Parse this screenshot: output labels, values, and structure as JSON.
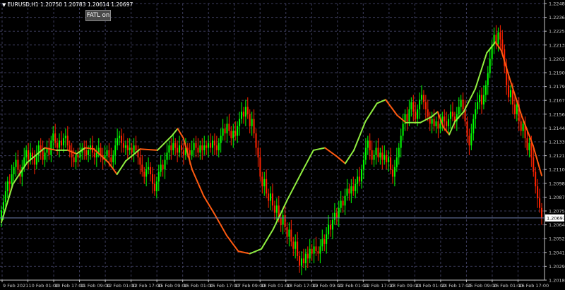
{
  "header": {
    "symbol_menu_icon": "triangle-down-icon",
    "symbol_info": "EURUSD,H1  1.20750 1.20783 1.20614 1.20697"
  },
  "indicator_button": {
    "label": "FATL on"
  },
  "colors": {
    "background": "#000000",
    "grid": "#3c3c5c",
    "axis": "#c8c8c8",
    "bull_candle": "#00ff00",
    "bear_candle": "#ff2200",
    "fatl_up": "#90ee40",
    "fatl_down": "#ff5a10",
    "price_line": "#7080b0"
  },
  "chart_data": {
    "type": "candlestick",
    "symbol": "EURUSD",
    "timeframe": "H1",
    "ylim": [
      1.2018,
      1.2248
    ],
    "y_ticks": [
      "1.22480",
      "1.22365",
      "1.22250",
      "1.22135",
      "1.22020",
      "1.21905",
      "1.21790",
      "1.21675",
      "1.21560",
      "1.21445",
      "1.21330",
      "1.21215",
      "1.21100",
      "1.20985",
      "1.20870",
      "1.20755",
      "1.20640",
      "1.20525",
      "1.20410",
      "1.20295",
      "1.20180"
    ],
    "x_ticks": [
      "9 Feb 2021",
      "10 Feb 01:00",
      "10 Feb 17:00",
      "11 Feb 09:00",
      "12 Feb 01:00",
      "12 Feb 17:00",
      "15 Feb 09:00",
      "16 Feb 01:00",
      "16 Feb 17:00",
      "17 Feb 09:00",
      "18 Feb 01:00",
      "18 Feb 17:00",
      "19 Feb 09:00",
      "22 Feb 01:00",
      "22 Feb 17:00",
      "23 Feb 09:00",
      "24 Feb 01:00",
      "24 Feb 17:00",
      "25 Feb 09:00",
      "26 Feb 01:00",
      "26 Feb 17:00"
    ],
    "current_price": "1.20697",
    "fatl_anchors": [
      [
        0,
        1.2066
      ],
      [
        8,
        1.2098
      ],
      [
        18,
        1.2116
      ],
      [
        30,
        1.2128
      ],
      [
        38,
        1.2126
      ],
      [
        46,
        1.2126
      ],
      [
        52,
        1.2123
      ],
      [
        58,
        1.2128
      ],
      [
        64,
        1.2127
      ],
      [
        74,
        1.2116
      ],
      [
        80,
        1.2106
      ],
      [
        86,
        1.2117
      ],
      [
        96,
        1.2127
      ],
      [
        108,
        1.2126
      ],
      [
        118,
        1.2138
      ],
      [
        122,
        1.2144
      ],
      [
        126,
        1.2136
      ],
      [
        132,
        1.211
      ],
      [
        140,
        1.2088
      ],
      [
        148,
        1.2072
      ],
      [
        156,
        1.2055
      ],
      [
        164,
        1.2042
      ],
      [
        172,
        1.204
      ],
      [
        180,
        1.2044
      ],
      [
        188,
        1.206
      ],
      [
        198,
        1.2085
      ],
      [
        208,
        1.2108
      ],
      [
        216,
        1.2126
      ],
      [
        224,
        1.2128
      ],
      [
        232,
        1.2121
      ],
      [
        238,
        1.2115
      ],
      [
        244,
        1.2126
      ],
      [
        252,
        1.215
      ],
      [
        260,
        1.2165
      ],
      [
        266,
        1.2168
      ],
      [
        274,
        1.2155
      ],
      [
        280,
        1.2149
      ],
      [
        290,
        1.2149
      ],
      [
        298,
        1.2154
      ],
      [
        302,
        1.2158
      ],
      [
        306,
        1.2145
      ],
      [
        310,
        1.2139
      ],
      [
        314,
        1.215
      ],
      [
        320,
        1.2158
      ],
      [
        328,
        1.2177
      ],
      [
        336,
        1.2207
      ],
      [
        342,
        1.2216
      ],
      [
        346,
        1.2209
      ],
      [
        352,
        1.2185
      ],
      [
        360,
        1.2155
      ],
      [
        368,
        1.213
      ],
      [
        374,
        1.2105
      ]
    ],
    "candles": [
      [
        0,
        1.2068,
        1.2076
      ],
      [
        1,
        1.2076,
        1.2083
      ],
      [
        2,
        1.2083,
        1.2092
      ],
      [
        3,
        1.2092,
        1.21
      ],
      [
        4,
        1.21,
        1.2098
      ],
      [
        5,
        1.2098,
        1.2106
      ],
      [
        6,
        1.2106,
        1.2112
      ],
      [
        7,
        1.2112,
        1.2118
      ],
      [
        8,
        1.2118,
        1.211
      ],
      [
        9,
        1.211,
        1.2104
      ],
      [
        10,
        1.2104,
        1.2112
      ],
      [
        11,
        1.2112,
        1.212
      ],
      [
        12,
        1.212,
        1.2126
      ],
      [
        13,
        1.2126,
        1.2118
      ],
      [
        14,
        1.2118,
        1.2124
      ],
      [
        15,
        1.2124,
        1.212
      ],
      [
        16,
        1.212,
        1.2114
      ],
      [
        17,
        1.2114,
        1.2122
      ],
      [
        18,
        1.2122,
        1.213
      ],
      [
        19,
        1.213,
        1.2126
      ],
      [
        20,
        1.2126,
        1.2118
      ],
      [
        21,
        1.2118,
        1.2124
      ],
      [
        22,
        1.2124,
        1.2128
      ],
      [
        23,
        1.2128,
        1.2122
      ],
      [
        24,
        1.2122,
        1.2134
      ],
      [
        25,
        1.2134,
        1.214
      ],
      [
        26,
        1.214,
        1.2132
      ],
      [
        27,
        1.2132,
        1.2128
      ],
      [
        28,
        1.2128,
        1.2134
      ],
      [
        29,
        1.2134,
        1.213
      ],
      [
        30,
        1.213,
        1.2136
      ],
      [
        31,
        1.2136,
        1.2138
      ],
      [
        32,
        1.2138,
        1.213
      ],
      [
        33,
        1.213,
        1.2126
      ],
      [
        34,
        1.2126,
        1.212
      ],
      [
        35,
        1.212,
        1.2116
      ],
      [
        36,
        1.2116,
        1.2122
      ],
      [
        37,
        1.2122,
        1.212
      ],
      [
        38,
        1.212,
        1.2124
      ],
      [
        39,
        1.2124,
        1.2128
      ],
      [
        40,
        1.2128,
        1.2126
      ],
      [
        41,
        1.2126,
        1.2122
      ],
      [
        42,
        1.2122,
        1.2126
      ],
      [
        43,
        1.2126,
        1.213
      ],
      [
        44,
        1.213,
        1.2124
      ],
      [
        45,
        1.2124,
        1.212
      ],
      [
        46,
        1.212,
        1.2124
      ],
      [
        47,
        1.2124,
        1.2128
      ],
      [
        48,
        1.2128,
        1.2122
      ],
      [
        49,
        1.2122,
        1.2118
      ],
      [
        50,
        1.2118,
        1.2122
      ],
      [
        51,
        1.2122,
        1.2126
      ],
      [
        52,
        1.2126,
        1.212
      ],
      [
        53,
        1.212,
        1.2116
      ],
      [
        54,
        1.2116,
        1.2122
      ],
      [
        55,
        1.2122,
        1.213
      ],
      [
        56,
        1.213,
        1.2136
      ],
      [
        57,
        1.2136,
        1.2138
      ],
      [
        58,
        1.2138,
        1.2132
      ],
      [
        59,
        1.2132,
        1.2128
      ],
      [
        60,
        1.2128,
        1.213
      ],
      [
        61,
        1.213,
        1.2126
      ],
      [
        62,
        1.2126,
        1.2128
      ],
      [
        63,
        1.2128,
        1.2124
      ],
      [
        64,
        1.2124,
        1.213
      ],
      [
        65,
        1.213,
        1.2126
      ],
      [
        66,
        1.2126,
        1.212
      ],
      [
        67,
        1.212,
        1.2114
      ],
      [
        68,
        1.2114,
        1.2108
      ],
      [
        69,
        1.2108,
        1.2104
      ],
      [
        70,
        1.2104,
        1.211
      ],
      [
        71,
        1.211,
        1.2112
      ],
      [
        72,
        1.2112,
        1.2106
      ],
      [
        73,
        1.2106,
        1.2098
      ],
      [
        74,
        1.2098,
        1.2092
      ],
      [
        75,
        1.2092,
        1.21
      ],
      [
        76,
        1.21,
        1.2108
      ],
      [
        77,
        1.2108,
        1.2114
      ],
      [
        78,
        1.2114,
        1.211
      ],
      [
        79,
        1.211,
        1.2118
      ],
      [
        80,
        1.2118,
        1.2124
      ],
      [
        81,
        1.2124,
        1.213
      ],
      [
        82,
        1.213,
        1.2126
      ],
      [
        83,
        1.2126,
        1.2132
      ],
      [
        84,
        1.2132,
        1.2128
      ],
      [
        85,
        1.2128,
        1.2124
      ],
      [
        86,
        1.2124,
        1.213
      ],
      [
        87,
        1.213,
        1.2126
      ],
      [
        88,
        1.2126,
        1.2122
      ],
      [
        89,
        1.2122,
        1.2128
      ],
      [
        90,
        1.2128,
        1.2126
      ],
      [
        91,
        1.2126,
        1.2122
      ],
      [
        92,
        1.2122,
        1.2126
      ],
      [
        93,
        1.2126,
        1.2132
      ],
      [
        94,
        1.2132,
        1.2128
      ],
      [
        95,
        1.2128,
        1.2124
      ],
      [
        96,
        1.2124,
        1.213
      ],
      [
        97,
        1.213,
        1.2126
      ],
      [
        98,
        1.2126,
        1.213
      ],
      [
        99,
        1.213,
        1.2128
      ],
      [
        100,
        1.2128,
        1.2132
      ],
      [
        101,
        1.2132,
        1.2128
      ],
      [
        102,
        1.2128,
        1.2134
      ],
      [
        103,
        1.2134,
        1.213
      ],
      [
        104,
        1.213,
        1.2126
      ],
      [
        105,
        1.2126,
        1.2132
      ],
      [
        106,
        1.2132,
        1.2138
      ],
      [
        107,
        1.2138,
        1.2144
      ],
      [
        108,
        1.2144,
        1.214
      ],
      [
        109,
        1.214,
        1.2148
      ],
      [
        110,
        1.2148,
        1.2142
      ],
      [
        111,
        1.2142,
        1.2136
      ],
      [
        112,
        1.2136,
        1.2142
      ],
      [
        113,
        1.2142,
        1.2138
      ],
      [
        114,
        1.2138,
        1.2146
      ],
      [
        115,
        1.2146,
        1.2152
      ],
      [
        116,
        1.2152,
        1.2158
      ],
      [
        117,
        1.2158,
        1.2154
      ],
      [
        118,
        1.2154,
        1.2162
      ],
      [
        119,
        1.2162,
        1.2156
      ],
      [
        120,
        1.2156,
        1.2146
      ],
      [
        121,
        1.2146,
        1.2152
      ],
      [
        122,
        1.2152,
        1.214
      ],
      [
        123,
        1.214,
        1.2128
      ],
      [
        124,
        1.2128,
        1.212
      ],
      [
        125,
        1.212,
        1.2104
      ],
      [
        126,
        1.2104,
        1.2096
      ],
      [
        127,
        1.2096,
        1.2102
      ],
      [
        128,
        1.2102,
        1.209
      ],
      [
        129,
        1.209,
        1.2084
      ],
      [
        130,
        1.2084,
        1.209
      ],
      [
        131,
        1.209,
        1.208
      ],
      [
        132,
        1.208,
        1.2074
      ],
      [
        133,
        1.2074,
        1.208
      ],
      [
        134,
        1.208,
        1.207
      ],
      [
        135,
        1.207,
        1.2064
      ],
      [
        136,
        1.2064,
        1.2072
      ],
      [
        137,
        1.2072,
        1.2062
      ],
      [
        138,
        1.2062,
        1.2054
      ],
      [
        139,
        1.2054,
        1.206
      ],
      [
        140,
        1.206,
        1.205
      ],
      [
        141,
        1.205,
        1.2044
      ],
      [
        142,
        1.2044,
        1.205
      ],
      [
        143,
        1.205,
        1.2038
      ],
      [
        144,
        1.2038,
        1.203
      ],
      [
        145,
        1.203,
        1.2036
      ],
      [
        146,
        1.2036,
        1.2032
      ],
      [
        147,
        1.2032,
        1.204
      ],
      [
        148,
        1.204,
        1.2036
      ],
      [
        149,
        1.2036,
        1.2044
      ],
      [
        150,
        1.2044,
        1.204
      ],
      [
        151,
        1.204,
        1.2046
      ],
      [
        152,
        1.2046,
        1.2042
      ],
      [
        153,
        1.2042,
        1.204
      ],
      [
        154,
        1.204,
        1.2046
      ],
      [
        155,
        1.2046,
        1.2052
      ],
      [
        156,
        1.2052,
        1.2048
      ],
      [
        157,
        1.2048,
        1.2056
      ],
      [
        158,
        1.2056,
        1.2064
      ],
      [
        159,
        1.2064,
        1.206
      ],
      [
        160,
        1.206,
        1.2068
      ],
      [
        161,
        1.2068,
        1.2074
      ],
      [
        162,
        1.2074,
        1.207
      ],
      [
        163,
        1.207,
        1.2078
      ],
      [
        164,
        1.2078,
        1.2084
      ],
      [
        165,
        1.2084,
        1.208
      ],
      [
        166,
        1.208,
        1.2088
      ],
      [
        167,
        1.2088,
        1.2094
      ],
      [
        168,
        1.2094,
        1.209
      ],
      [
        169,
        1.209,
        1.2096
      ],
      [
        170,
        1.2096,
        1.2092
      ],
      [
        171,
        1.2092,
        1.2098
      ],
      [
        172,
        1.2098,
        1.2104
      ],
      [
        173,
        1.2104,
        1.21
      ],
      [
        174,
        1.21,
        1.211
      ],
      [
        175,
        1.211,
        1.2118
      ],
      [
        176,
        1.2118,
        1.2128
      ],
      [
        177,
        1.2128,
        1.2134
      ],
      [
        178,
        1.2134,
        1.2126
      ],
      [
        179,
        1.2126,
        1.2118
      ],
      [
        180,
        1.2118,
        1.2122
      ],
      [
        181,
        1.2122,
        1.2128
      ],
      [
        182,
        1.2128,
        1.212
      ],
      [
        183,
        1.212,
        1.2124
      ],
      [
        184,
        1.2124,
        1.2118
      ],
      [
        185,
        1.2118,
        1.2122
      ],
      [
        186,
        1.2122,
        1.2116
      ],
      [
        187,
        1.2116,
        1.212
      ],
      [
        188,
        1.212,
        1.211
      ],
      [
        189,
        1.211,
        1.2104
      ],
      [
        190,
        1.2104,
        1.2112
      ],
      [
        191,
        1.2112,
        1.212
      ],
      [
        192,
        1.212,
        1.2128
      ],
      [
        193,
        1.2128,
        1.2138
      ],
      [
        194,
        1.2138,
        1.2148
      ],
      [
        195,
        1.2148,
        1.2156
      ],
      [
        196,
        1.2156,
        1.215
      ],
      [
        197,
        1.215,
        1.216
      ],
      [
        198,
        1.216,
        1.2166
      ],
      [
        199,
        1.2166,
        1.2158
      ],
      [
        200,
        1.2158,
        1.2152
      ],
      [
        201,
        1.2152,
        1.216
      ],
      [
        202,
        1.216,
        1.2168
      ],
      [
        203,
        1.2168,
        1.2172
      ],
      [
        204,
        1.2172,
        1.2166
      ],
      [
        205,
        1.2166,
        1.216
      ],
      [
        206,
        1.216,
        1.2154
      ],
      [
        207,
        1.2154,
        1.2148
      ],
      [
        208,
        1.2148,
        1.2152
      ],
      [
        209,
        1.2152,
        1.2146
      ],
      [
        210,
        1.2146,
        1.215
      ],
      [
        211,
        1.215,
        1.2144
      ],
      [
        212,
        1.2144,
        1.2148
      ],
      [
        213,
        1.2148,
        1.2154
      ],
      [
        214,
        1.2154,
        1.215
      ],
      [
        215,
        1.215,
        1.2146
      ],
      [
        216,
        1.2146,
        1.2152
      ],
      [
        217,
        1.2152,
        1.2158
      ],
      [
        218,
        1.2158,
        1.2154
      ],
      [
        219,
        1.2154,
        1.215
      ],
      [
        220,
        1.215,
        1.2156
      ],
      [
        221,
        1.2156,
        1.2162
      ],
      [
        222,
        1.2162,
        1.2168
      ],
      [
        223,
        1.2168,
        1.216
      ],
      [
        224,
        1.216,
        1.215
      ],
      [
        225,
        1.215,
        1.2138
      ],
      [
        226,
        1.2138,
        1.213
      ],
      [
        227,
        1.213,
        1.214
      ],
      [
        228,
        1.214,
        1.2152
      ],
      [
        229,
        1.2152,
        1.216
      ],
      [
        230,
        1.216,
        1.2166
      ],
      [
        231,
        1.2166,
        1.2172
      ],
      [
        232,
        1.2172,
        1.2164
      ],
      [
        233,
        1.2164,
        1.2172
      ],
      [
        234,
        1.2172,
        1.218
      ],
      [
        235,
        1.218,
        1.219
      ],
      [
        236,
        1.219,
        1.2202
      ],
      [
        237,
        1.2202,
        1.2214
      ],
      [
        238,
        1.2214,
        1.2222
      ],
      [
        239,
        1.2222,
        1.2214
      ],
      [
        240,
        1.2214,
        1.2224
      ],
      [
        241,
        1.2224,
        1.2218
      ],
      [
        242,
        1.2218,
        1.221
      ],
      [
        243,
        1.221,
        1.2196
      ],
      [
        244,
        1.2196,
        1.218
      ],
      [
        245,
        1.218,
        1.217
      ],
      [
        246,
        1.217,
        1.2176
      ],
      [
        247,
        1.2176,
        1.2164
      ],
      [
        248,
        1.2164,
        1.2156
      ],
      [
        249,
        1.2156,
        1.2164
      ],
      [
        250,
        1.2164,
        1.215
      ],
      [
        251,
        1.215,
        1.2142
      ],
      [
        252,
        1.2142,
        1.2148
      ],
      [
        253,
        1.2148,
        1.2136
      ],
      [
        254,
        1.2136,
        1.2126
      ],
      [
        255,
        1.2126,
        1.2132
      ],
      [
        256,
        1.2132,
        1.212
      ],
      [
        257,
        1.212,
        1.2108
      ],
      [
        258,
        1.2108,
        1.2096
      ],
      [
        259,
        1.2096,
        1.2086
      ],
      [
        260,
        1.2086,
        1.2078
      ],
      [
        261,
        1.2078,
        1.207
      ]
    ]
  }
}
